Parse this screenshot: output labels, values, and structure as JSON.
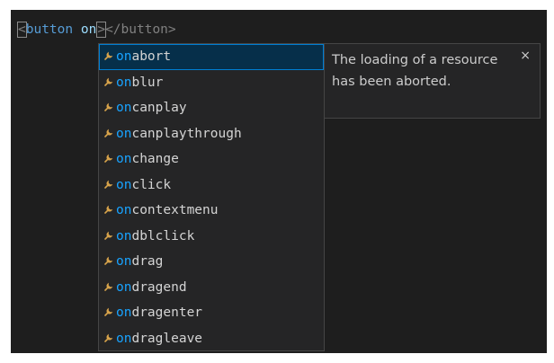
{
  "editor": {
    "code": {
      "open_bracket": "<",
      "tag_name": "button",
      "space": " ",
      "typed_attr": "on",
      "close_bracket": ">",
      "closing_tag": "</button>"
    }
  },
  "suggest": {
    "match_prefix": "on",
    "items": [
      {
        "rest": "abort"
      },
      {
        "rest": "blur"
      },
      {
        "rest": "canplay"
      },
      {
        "rest": "canplaythrough"
      },
      {
        "rest": "change"
      },
      {
        "rest": "click"
      },
      {
        "rest": "contextmenu"
      },
      {
        "rest": "dblclick"
      },
      {
        "rest": "drag"
      },
      {
        "rest": "dragend"
      },
      {
        "rest": "dragenter"
      },
      {
        "rest": "dragleave"
      }
    ],
    "selected_index": 0,
    "item_icon": "property-wrench-icon",
    "colors": {
      "match": "#18a3ff",
      "icon": "#d7a34b",
      "selected_bg": "#062f4a",
      "selected_border": "#007fd4"
    }
  },
  "docs": {
    "text": "The loading of a resource has been aborted.",
    "close_label": "×"
  }
}
